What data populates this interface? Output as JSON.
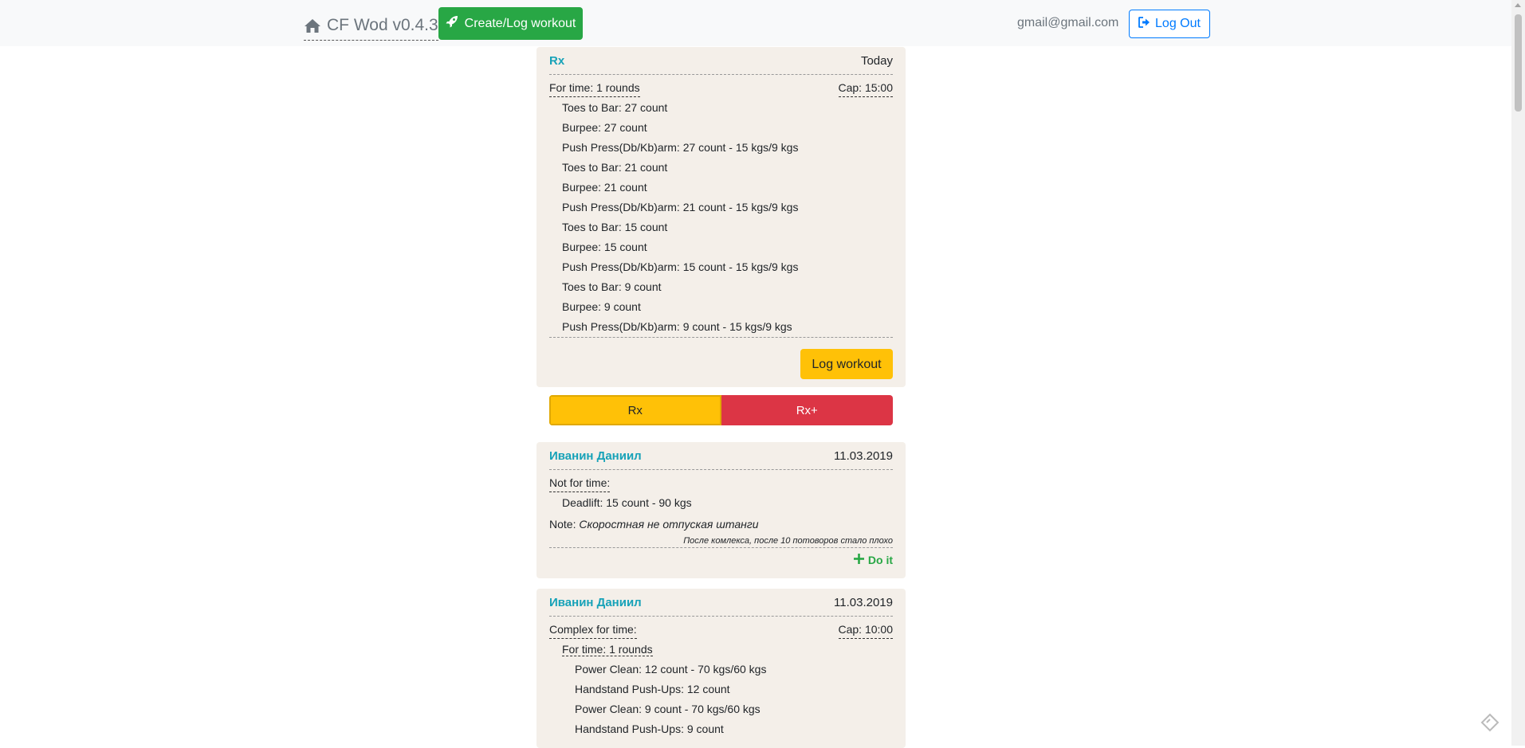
{
  "nav": {
    "brand": "CF Wod v0.4.3",
    "create_label": "Create/Log workout",
    "user_email": "gmail@gmail.com",
    "logout_label": "Log Out"
  },
  "current_workout": {
    "author": "Rx",
    "date": "Today",
    "type": "For time: 1 rounds",
    "cap": "Cap: 15:00",
    "exercises": [
      "Toes to Bar: 27 count",
      "Burpee: 27 count",
      "Push Press(Db/Kb)arm: 27 count - 15 kgs/9 kgs",
      "Toes to Bar: 21 count",
      "Burpee: 21 count",
      "Push Press(Db/Kb)arm: 21 count - 15 kgs/9 kgs",
      "Toes to Bar: 15 count",
      "Burpee: 15 count",
      "Push Press(Db/Kb)arm: 15 count - 15 kgs/9 kgs",
      "Toes to Bar: 9 count",
      "Burpee: 9 count",
      "Push Press(Db/Kb)arm: 9 count - 15 kgs/9 kgs"
    ],
    "log_label": "Log workout"
  },
  "rx_toggle": {
    "left": "Rx",
    "right": "Rx+",
    "selected": "Rx"
  },
  "feed": [
    {
      "author": "Иванин Даниил",
      "date": "11.03.2019",
      "type": "Not for time:",
      "exercises": [
        "Deadlift: 15 count - 90 kgs"
      ],
      "note_label": "Note:",
      "note": "Скоростная не отпуская штанги",
      "note_small": "После комлекса, после 10 потоворов стало плохо",
      "do_it": "Do it"
    },
    {
      "author": "Иванин Даниил",
      "date": "11.03.2019",
      "type": "Complex for time:",
      "cap": "Cap: 10:00",
      "sub_type": "For time: 1 rounds",
      "exercises": [
        "Power Clean: 12 count - 70 kgs/60 kgs",
        "Handstand Push-Ups: 12 count",
        "Power Clean: 9 count - 70 kgs/60 kgs",
        "Handstand Push-Ups: 9 count"
      ]
    }
  ],
  "colors": {
    "accent_green": "#28a745",
    "accent_blue": "#007bff",
    "author_teal": "#17a2b8",
    "warning_yellow": "#ffc107",
    "danger_red": "#dc3545",
    "card_bg": "#f4efe9"
  }
}
